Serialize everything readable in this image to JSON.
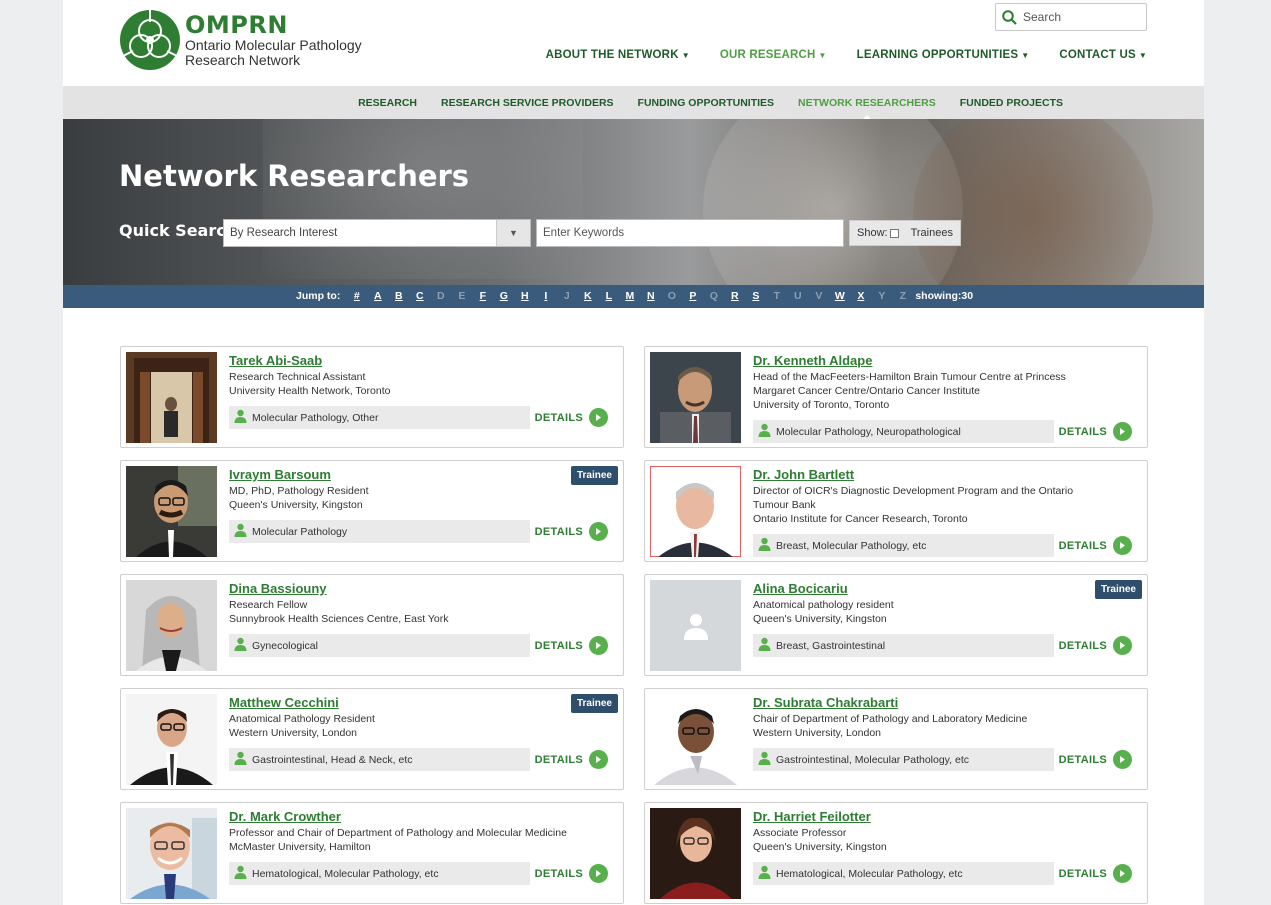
{
  "brand": {
    "name": "OMPRN",
    "sub1": "Ontario Molecular Pathology",
    "sub2": "Research Network",
    "color": "#2e7d32"
  },
  "search": {
    "placeholder": "Search"
  },
  "mainnav": [
    "ABOUT THE NETWORK",
    "OUR RESEARCH",
    "LEARNING OPPORTUNITIES",
    "CONTACT US"
  ],
  "subnav": [
    "RESEARCH",
    "RESEARCH SERVICE PROVIDERS",
    "FUNDING OPPORTUNITIES",
    "NETWORK RESEARCHERS",
    "FUNDED PROJECTS"
  ],
  "hero": {
    "title": "Network Researchers",
    "quick_search_label": "Quick Search:",
    "select_value": "By Research Interest",
    "keywords_placeholder": "Enter Keywords",
    "show_label": "Show:",
    "trainees_label": "Trainees"
  },
  "jump": {
    "label": "Jump to:",
    "letters": [
      {
        "l": "#",
        "on": true
      },
      {
        "l": "A",
        "on": true
      },
      {
        "l": "B",
        "on": true
      },
      {
        "l": "C",
        "on": true
      },
      {
        "l": "D",
        "on": false
      },
      {
        "l": "E",
        "on": false
      },
      {
        "l": "F",
        "on": true
      },
      {
        "l": "G",
        "on": true
      },
      {
        "l": "H",
        "on": true
      },
      {
        "l": "I",
        "on": true
      },
      {
        "l": "J",
        "on": false
      },
      {
        "l": "K",
        "on": true
      },
      {
        "l": "L",
        "on": true
      },
      {
        "l": "M",
        "on": true
      },
      {
        "l": "N",
        "on": true
      },
      {
        "l": "O",
        "on": false
      },
      {
        "l": "P",
        "on": true
      },
      {
        "l": "Q",
        "on": false
      },
      {
        "l": "R",
        "on": true
      },
      {
        "l": "S",
        "on": true
      },
      {
        "l": "T",
        "on": false
      },
      {
        "l": "U",
        "on": false
      },
      {
        "l": "V",
        "on": false
      },
      {
        "l": "W",
        "on": true
      },
      {
        "l": "X",
        "on": true
      },
      {
        "l": "Y",
        "on": false
      },
      {
        "l": "Z",
        "on": false
      }
    ],
    "showing": "showing:30"
  },
  "details_label": "DETAILS",
  "trainee_badge": "Trainee",
  "researchers": [
    {
      "name": "Tarek Abi-Saab",
      "lines": [
        "Research Technical Assistant",
        "University Health Network, Toronto"
      ],
      "tags": "Molecular Pathology, Other",
      "trainee": false
    },
    {
      "name": "Dr. Kenneth Aldape",
      "lines": [
        "Head of the MacFeeters-Hamilton Brain Tumour Centre at Princess",
        "Margaret Cancer Centre/Ontario Cancer Institute",
        "University of Toronto, Toronto"
      ],
      "tags": "Molecular Pathology, Neuropathological",
      "trainee": false
    },
    {
      "name": "Ivraym Barsoum",
      "lines": [
        "MD, PhD, Pathology Resident",
        "Queen's University, Kingston"
      ],
      "tags": "Molecular Pathology",
      "trainee": true
    },
    {
      "name": "Dr. John Bartlett",
      "lines": [
        "Director of OICR's Diagnostic Development Program and the Ontario",
        "Tumour Bank",
        "Ontario Institute for Cancer Research, Toronto"
      ],
      "tags": "Breast, Molecular Pathology, etc",
      "trainee": false
    },
    {
      "name": "Dina Bassiouny",
      "lines": [
        "Research Fellow",
        "Sunnybrook Health Sciences Centre, East York"
      ],
      "tags": "Gynecological",
      "trainee": false
    },
    {
      "name": "Alina Bocicariu",
      "lines": [
        "Anatomical pathology resident",
        "Queen's University, Kingston"
      ],
      "tags": "Breast, Gastrointestinal",
      "trainee": true
    },
    {
      "name": "Matthew Cecchini",
      "lines": [
        "Anatomical Pathology Resident",
        "Western University, London"
      ],
      "tags": "Gastrointestinal, Head & Neck, etc",
      "trainee": true
    },
    {
      "name": "Dr. Subrata Chakrabarti",
      "lines": [
        "Chair of Department of Pathology and Laboratory Medicine",
        "Western University, London"
      ],
      "tags": "Gastrointestinal, Molecular Pathology, etc",
      "trainee": false
    },
    {
      "name": "Dr. Mark Crowther",
      "lines": [
        "Professor and Chair of Department of Pathology and Molecular Medicine",
        "McMaster University, Hamilton"
      ],
      "tags": "Hematological, Molecular Pathology, etc",
      "trainee": false
    },
    {
      "name": "Dr. Harriet Feilotter",
      "lines": [
        "Associate Professor",
        "Queen's University, Kingston"
      ],
      "tags": "Hematological, Molecular Pathology, etc",
      "trainee": false
    }
  ]
}
